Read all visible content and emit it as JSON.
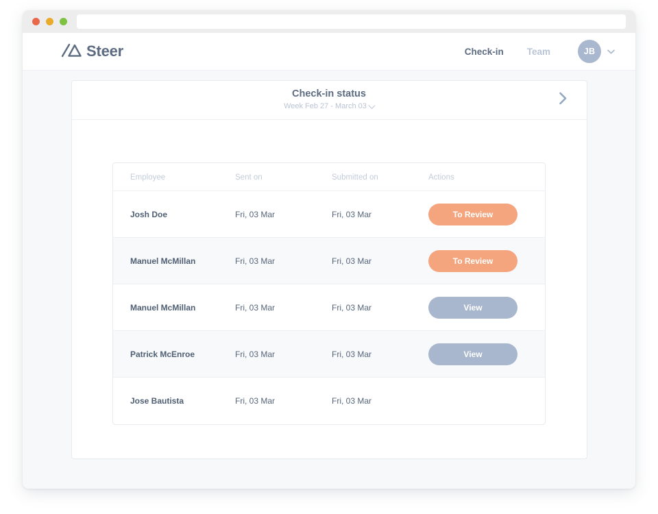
{
  "browser": {
    "traffic_lights": [
      "close-red",
      "minimize-yellow",
      "maximize-green"
    ],
    "url_value": "",
    "url_placeholder": ""
  },
  "app": {
    "brand": "Steer",
    "logo_icon": "steer-triangle-logo",
    "nav": [
      {
        "label": "Check-in",
        "active": true
      },
      {
        "label": "Team",
        "active": false
      }
    ],
    "avatar": {
      "initials": "JB",
      "chevron_icon": "chevron-down-icon"
    }
  },
  "card": {
    "title": "Check-in status",
    "subtitle": "Week Feb 27 - March 03",
    "subtitle_chevron_icon": "chevron-down-icon",
    "next_icon": "chevron-right-icon"
  },
  "table": {
    "columns": [
      "Employee",
      "Sent on",
      "Submitted on",
      "Actions"
    ],
    "rows": [
      {
        "employee": "Josh Doe",
        "sent_on": "Fri, 03 Mar",
        "submitted_on": "Fri, 03 Mar",
        "action": "To Review",
        "action_kind": "review"
      },
      {
        "employee": "Manuel McMillan",
        "sent_on": "Fri, 03 Mar",
        "submitted_on": "Fri, 03 Mar",
        "action": "To Review",
        "action_kind": "review"
      },
      {
        "employee": "Manuel McMillan",
        "sent_on": "Fri, 03 Mar",
        "submitted_on": "Fri, 03 Mar",
        "action": "View",
        "action_kind": "view"
      },
      {
        "employee": "Patrick McEnroe",
        "sent_on": "Fri, 03 Mar",
        "submitted_on": "Fri, 03 Mar",
        "action": "View",
        "action_kind": "view"
      },
      {
        "employee": "Jose Bautista",
        "sent_on": "Fri, 03 Mar",
        "submitted_on": "Fri, 03 Mar",
        "action": "",
        "action_kind": "none"
      }
    ]
  },
  "colors": {
    "brand_text": "#5c6b80",
    "muted_text": "#b9c4d4",
    "review_pill": "#f5a57e",
    "view_pill": "#a8b7cd",
    "page_bg": "#f7f8fa",
    "light_red": "#e8684a",
    "light_yellow": "#e9ab2b",
    "light_green": "#7ec242"
  }
}
